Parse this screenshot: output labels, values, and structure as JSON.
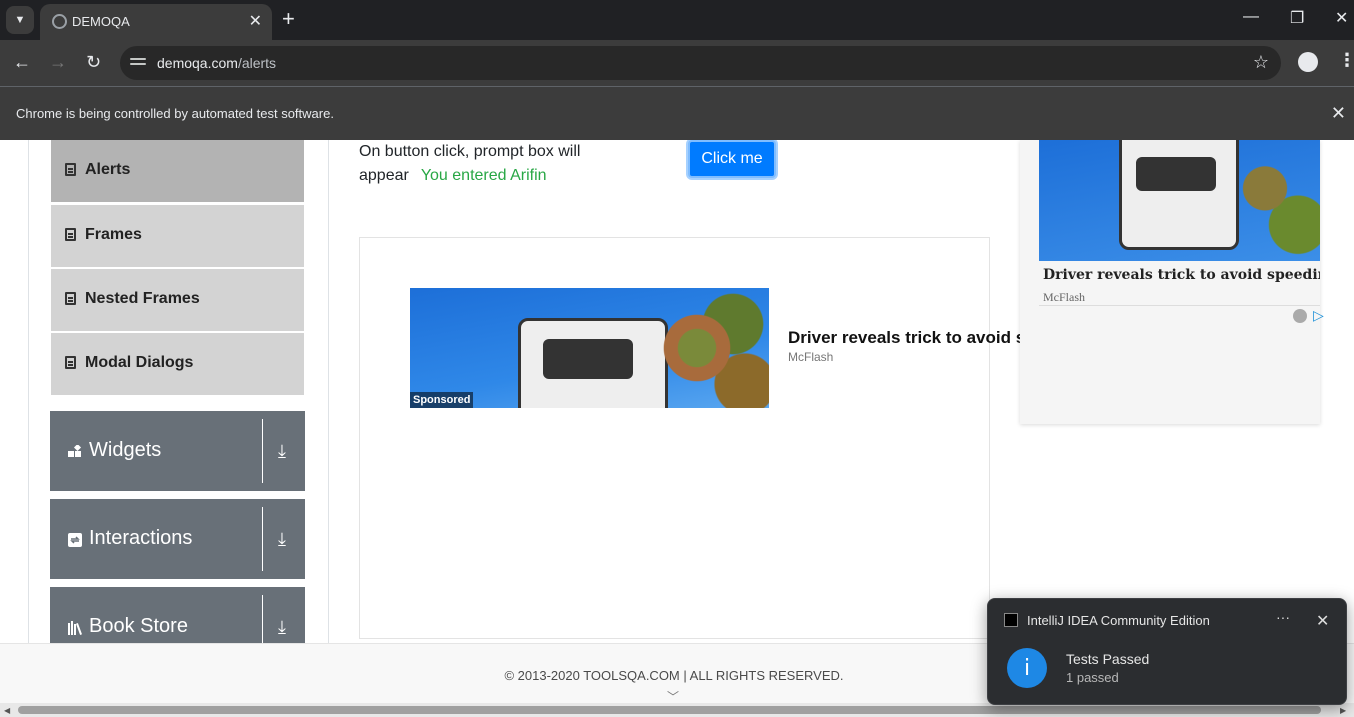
{
  "browser": {
    "tab_title": "DEMOQA",
    "url_host": "demoqa.com",
    "url_path": "/alerts",
    "infobar_text": "Chrome is being controlled by automated test software."
  },
  "sidebar": {
    "items": [
      {
        "label": "Alerts",
        "active": true
      },
      {
        "label": "Frames",
        "active": false
      },
      {
        "label": "Nested Frames",
        "active": false
      },
      {
        "label": "Modal Dialogs",
        "active": false
      }
    ],
    "groups": [
      {
        "label": "Widgets",
        "icon": "widgets-icon"
      },
      {
        "label": "Interactions",
        "icon": "interactions-icon"
      },
      {
        "label": "Book Store",
        "icon": "book-store-icon"
      }
    ]
  },
  "main": {
    "prompt_description": "On button click, prompt box will appear",
    "prompt_result": "You entered Arifin",
    "click_button_label": "Click me"
  },
  "ad": {
    "sponsored_label": "Sponsored",
    "headline": "Driver reveals trick to avoid sp",
    "source": "McFlash"
  },
  "side_ad": {
    "headline": "Driver reveals trick to avoid speeding fines",
    "source": "McFlash"
  },
  "footer": {
    "text": "© 2013-2020 TOOLSQA.COM | ALL RIGHTS RESERVED."
  },
  "notification": {
    "app_name": "IntelliJ IDEA Community Edition",
    "title": "Tests Passed",
    "message": "1 passed"
  },
  "colors": {
    "primary_button": "#007bff",
    "success_text": "#28a745",
    "sidebar_group": "#687078",
    "notification_info": "#1e88e5"
  }
}
